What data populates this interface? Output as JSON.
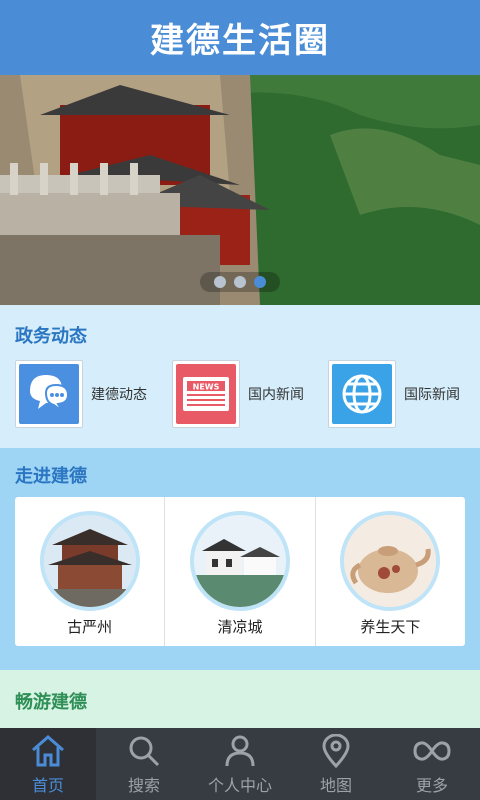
{
  "app": {
    "title": "建德生活圈"
  },
  "banner": {
    "dots": 3,
    "active_dot": 2
  },
  "news_section": {
    "title": "政务动态",
    "items": [
      {
        "label": "建德动态",
        "icon": "chat-bubble-icon",
        "color": "#4a8fe0"
      },
      {
        "label": "国内新闻",
        "icon": "newspaper-icon",
        "color": "#e85a66",
        "icon_text": "NEWS"
      },
      {
        "label": "国际新闻",
        "icon": "globe-icon",
        "color": "#3aa3e8"
      }
    ]
  },
  "visit_section": {
    "title": "走进建德",
    "items": [
      {
        "label": "古严州",
        "icon": "pagoda-image"
      },
      {
        "label": "清凉城",
        "icon": "village-image"
      },
      {
        "label": "养生天下",
        "icon": "teapot-image"
      }
    ]
  },
  "tour_section": {
    "title": "畅游建德"
  },
  "tabbar": {
    "active": 0,
    "tabs": [
      {
        "label": "首页",
        "icon": "home-icon"
      },
      {
        "label": "搜索",
        "icon": "search-icon"
      },
      {
        "label": "个人中心",
        "icon": "user-icon"
      },
      {
        "label": "地图",
        "icon": "map-pin-icon"
      },
      {
        "label": "更多",
        "icon": "infinity-icon"
      }
    ]
  },
  "colors": {
    "accent": "#4a8dd6",
    "tabbar_bg": "#373b42"
  }
}
